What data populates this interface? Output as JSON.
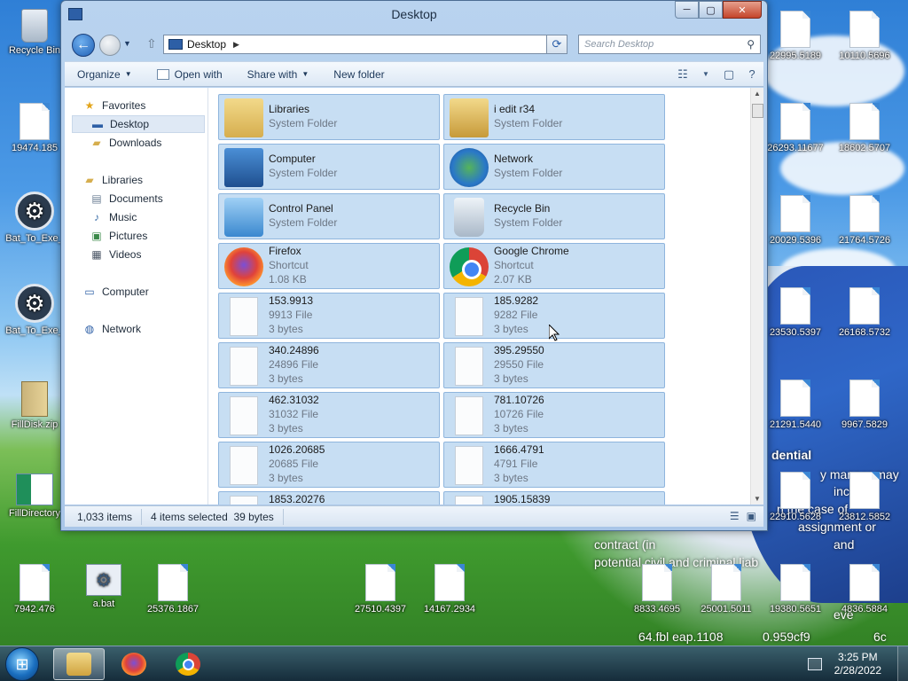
{
  "window": {
    "title": "Desktop",
    "address": "Desktop",
    "search_placeholder": "Search Desktop",
    "minimize": "─",
    "maximize": "▢",
    "close": "✕"
  },
  "toolbar": {
    "organize": "Organize",
    "open_with": "Open with",
    "share_with": "Share with",
    "new_folder": "New folder"
  },
  "navpane": {
    "favorites": "Favorites",
    "desktop": "Desktop",
    "downloads": "Downloads",
    "libraries": "Libraries",
    "documents": "Documents",
    "music": "Music",
    "pictures": "Pictures",
    "videos": "Videos",
    "computer": "Computer",
    "network": "Network"
  },
  "tiles": [
    {
      "name": "Libraries",
      "type": "System Folder",
      "size": "",
      "icon": "libraries-icon"
    },
    {
      "name": "i edit r34",
      "type": "System Folder",
      "size": "",
      "icon": "user-folder-icon"
    },
    {
      "name": "Computer",
      "type": "System Folder",
      "size": "",
      "icon": "computer-icon"
    },
    {
      "name": "Network",
      "type": "System Folder",
      "size": "",
      "icon": "network-icon"
    },
    {
      "name": "Control Panel",
      "type": "System Folder",
      "size": "",
      "icon": "control-panel-icon"
    },
    {
      "name": "Recycle Bin",
      "type": "System Folder",
      "size": "",
      "icon": "recycle-bin-icon"
    },
    {
      "name": "Firefox",
      "type": "Shortcut",
      "size": "1.08 KB",
      "icon": "firefox-icon"
    },
    {
      "name": "Google Chrome",
      "type": "Shortcut",
      "size": "2.07 KB",
      "icon": "chrome-icon"
    },
    {
      "name": "153.9913",
      "type": "9913 File",
      "size": "3 bytes",
      "icon": "file-icon"
    },
    {
      "name": "185.9282",
      "type": "9282 File",
      "size": "3 bytes",
      "icon": "file-icon"
    },
    {
      "name": "340.24896",
      "type": "24896 File",
      "size": "3 bytes",
      "icon": "file-icon"
    },
    {
      "name": "395.29550",
      "type": "29550 File",
      "size": "3 bytes",
      "icon": "file-icon"
    },
    {
      "name": "462.31032",
      "type": "31032 File",
      "size": "3 bytes",
      "icon": "file-icon"
    },
    {
      "name": "781.10726",
      "type": "10726 File",
      "size": "3 bytes",
      "icon": "file-icon"
    },
    {
      "name": "1026.20685",
      "type": "20685 File",
      "size": "3 bytes",
      "icon": "file-icon"
    },
    {
      "name": "1666.4791",
      "type": "4791 File",
      "size": "3 bytes",
      "icon": "file-icon"
    },
    {
      "name": "1853.20276",
      "type": "",
      "size": "",
      "icon": "file-icon"
    },
    {
      "name": "1905.15839",
      "type": "",
      "size": "",
      "icon": "file-icon"
    }
  ],
  "status": {
    "item_count": "1,033 items",
    "selected": "4 items selected",
    "selected_size": "39 bytes"
  },
  "desktop_icons": {
    "recycle_bin": "Recycle Bin",
    "f19474": "19474.185",
    "bat1": "Bat_To_Exe_",
    "bat2": "Bat_To_Exe_",
    "filldisk": "FillDisk.zip",
    "filldir": "FillDirectory",
    "f7942": "7942.476",
    "abat": "a.bat",
    "f25376": "25376.1867",
    "f27510": "27510.4397",
    "f14167": "14167.2934",
    "f8833": "8833.4695",
    "f25001": "25001.5011",
    "f19380": "19380.5651",
    "f4836": "4836.5884",
    "f22995": "22995.5189",
    "f10110": "10110.5696",
    "f26293": "26293.11677",
    "f18602": "18602.5707",
    "f20029": "20029.5396",
    "f21764": "21764.5726",
    "f23530": "23530.5397",
    "f26168": "26168.5732",
    "f21291": "21291.5440",
    "f9967": "9967.5829",
    "f22910": "22910.5628",
    "f23812": "23812.5852"
  },
  "wallpaper_text": {
    "line1": "dential",
    "line2": "y manner may",
    "line3": "includ",
    "line4": "n the case of",
    "line5": "assignment or",
    "line6": "contract (in",
    "line7": "and",
    "line8": "potential civil and criminal liab",
    "line9": "eve",
    "line10": "64.fbl  eap.1108",
    "line11": "0.959cf9",
    "line12": "6c"
  },
  "taskbar": {
    "time": "3:25 PM",
    "date": "2/28/2022"
  }
}
